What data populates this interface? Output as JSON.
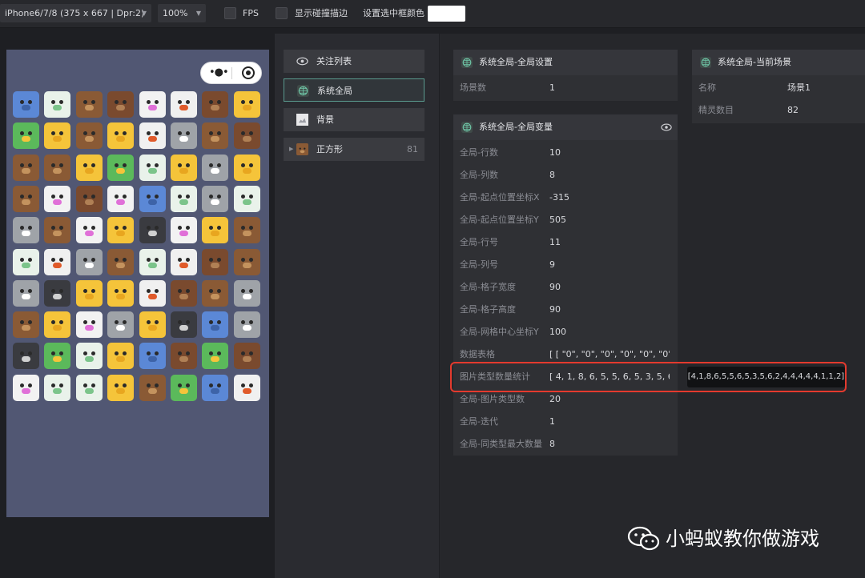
{
  "toolbar": {
    "device": "iPhone6/7/8 (375 x 667 | Dpr:2)",
    "zoom": "100%",
    "fps_label": "FPS",
    "collision_label": "显示碰撞描边",
    "select_color_label": "设置选中框颜色",
    "select_color": "#ffffff"
  },
  "preview": {
    "background": "#515773",
    "grid_rows": 10,
    "grid_cols": 8
  },
  "node_list": {
    "items": [
      {
        "label": "关注列表",
        "icon": "eye-icon"
      },
      {
        "label": "系统全局",
        "icon": "globe-icon"
      },
      {
        "label": "背景",
        "icon": "image-icon"
      },
      {
        "label": "正方形",
        "icon": "tile-icon",
        "count": "81"
      }
    ]
  },
  "global_settings": {
    "title": "系统全局-全局设置",
    "rows": [
      {
        "key": "场景数",
        "value": "1"
      }
    ]
  },
  "current_scene": {
    "title": "系统全局-当前场景",
    "rows": [
      {
        "key": "名称",
        "value": "场景1"
      },
      {
        "key": "精灵数目",
        "value": "82"
      }
    ]
  },
  "global_vars": {
    "title": "系统全局-全局变量",
    "rows": [
      {
        "key": "全局-行数",
        "value": "10"
      },
      {
        "key": "全局-列数",
        "value": "8"
      },
      {
        "key": "全局-起点位置坐标X",
        "value": "-315"
      },
      {
        "key": "全局-起点位置坐标Y",
        "value": "505"
      },
      {
        "key": "全局-行号",
        "value": "11"
      },
      {
        "key": "全局-列号",
        "value": "9"
      },
      {
        "key": "全局-格子宽度",
        "value": "90"
      },
      {
        "key": "全局-格子高度",
        "value": "90"
      },
      {
        "key": "全局-网格中心坐标Y",
        "value": "100"
      },
      {
        "key": "数据表格",
        "value": "[ [ \"0\", \"0\", \"0\", \"0\", \"0\", \"0\", \"0\""
      },
      {
        "key": "图片类型数量统计",
        "value": "[ 4, 1, 8, 6, 5, 5, 6, 5, 3, 5, 6, 2"
      },
      {
        "key": "全局-图片类型数",
        "value": "20"
      },
      {
        "key": "全局-迭代",
        "value": "1"
      },
      {
        "key": "全局-同类型最大数量",
        "value": "8"
      }
    ]
  },
  "tooltip": "[4,1,8,6,5,5,6,5,3,5,6,2,4,4,4,4,4,1,1,2]",
  "watermark": "小蚂蚁教你做游戏",
  "colors": {
    "accent_selected": "#5a9a8e",
    "highlight": "#e43a2e"
  }
}
